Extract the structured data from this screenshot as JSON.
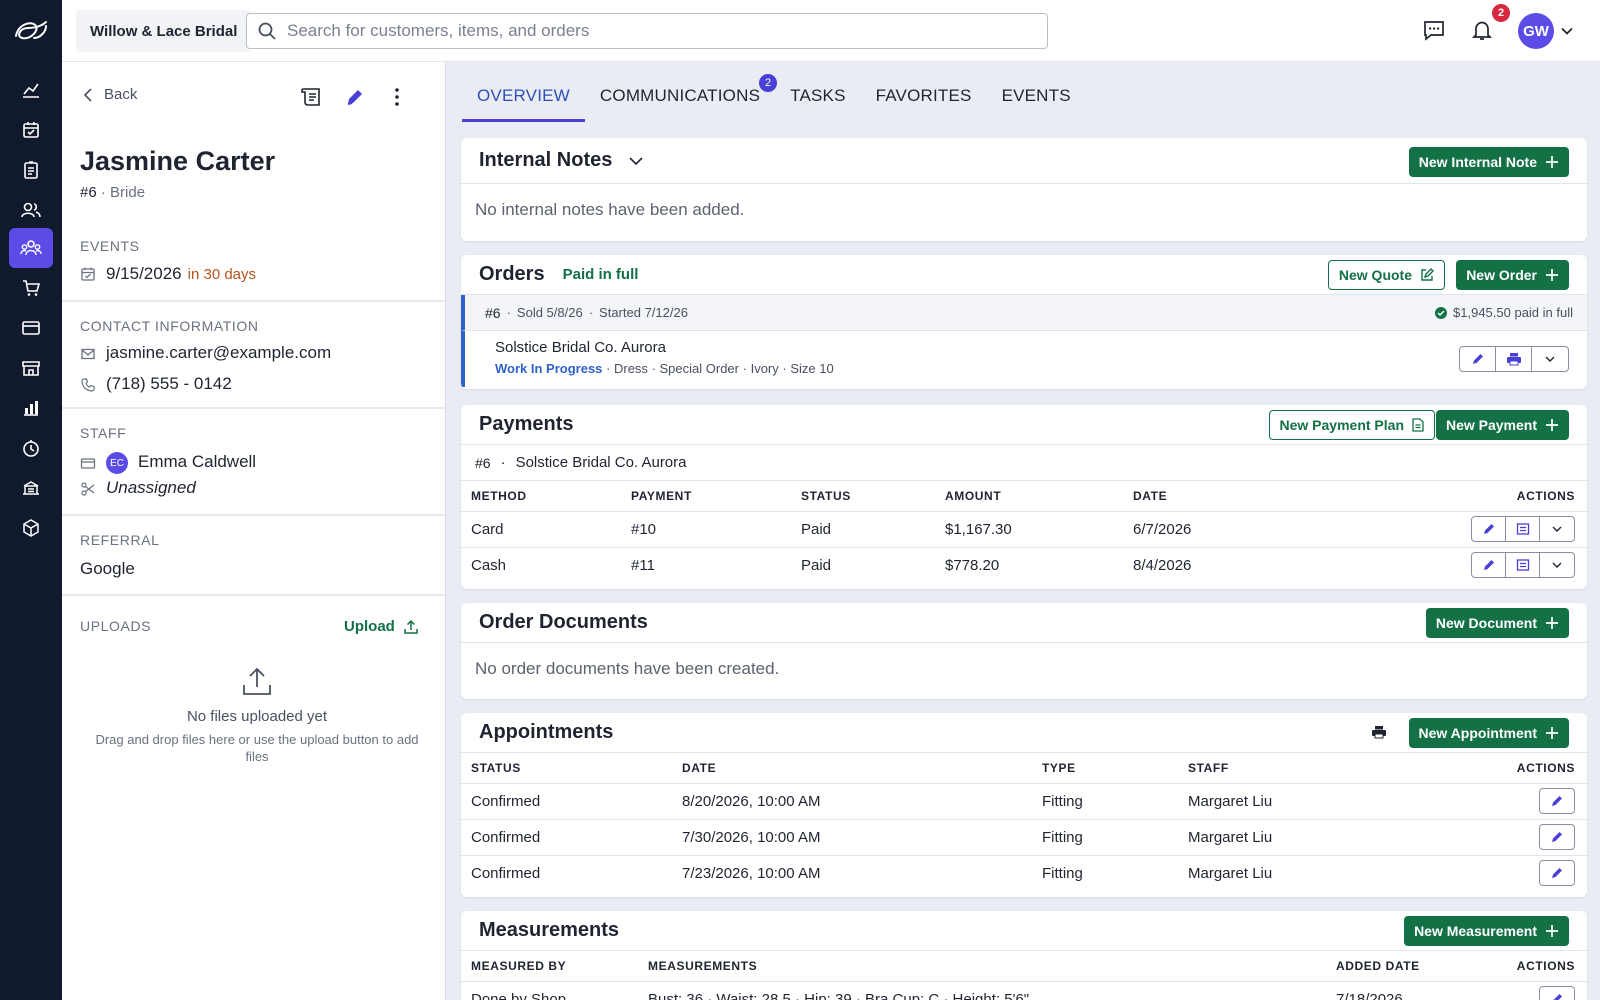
{
  "store": {
    "name": "Willow & Lace Bridal"
  },
  "search": {
    "placeholder": "Search for customers, items, and orders"
  },
  "topbar": {
    "notification_count": "2",
    "user_initials": "GW"
  },
  "rail": {
    "items": [
      "dashboard-icon",
      "calendar-check-icon",
      "clipboard-icon",
      "contacts-icon",
      "customers-icon",
      "cart-icon",
      "credit-card-icon",
      "storefront-icon",
      "reports-icon",
      "clock-icon",
      "orders-icon",
      "package-icon"
    ],
    "active": "customers-icon"
  },
  "customer": {
    "back_label": "Back",
    "name": "Jasmine Carter",
    "number": "#6",
    "role": "Bride",
    "events_label": "EVENTS",
    "event_date": "9/15/2026",
    "event_due": "in 30 days",
    "contact_label": "CONTACT INFORMATION",
    "email": "jasmine.carter@example.com",
    "phone": "(718) 555 - 0142",
    "staff_label": "STAFF",
    "staff_initials": "EC",
    "staff_name": "Emma Caldwell",
    "staff_unassigned": "Unassigned",
    "referral_label": "REFERRAL",
    "referral": "Google",
    "uploads_label": "UPLOADS",
    "upload_button": "Upload",
    "uploads_empty_title": "No files uploaded yet",
    "uploads_empty_text": "Drag and drop files here or use the upload button to add files"
  },
  "tabs": [
    {
      "label": "OVERVIEW",
      "active": true
    },
    {
      "label": "COMMUNICATIONS",
      "badge": "2"
    },
    {
      "label": "TASKS"
    },
    {
      "label": "FAVORITES"
    },
    {
      "label": "EVENTS"
    }
  ],
  "internal_notes": {
    "title": "Internal Notes",
    "button": "New Internal Note",
    "empty": "No internal notes have been added."
  },
  "orders": {
    "title": "Orders",
    "status": "Paid in full",
    "new_quote": "New Quote",
    "new_order": "New Order",
    "order_number": "#6",
    "sold": "Sold 5/8/26",
    "started": "Started 7/12/26",
    "paid_summary": "$1,945.50 paid in full",
    "item_name": "Solstice Bridal Co. Aurora",
    "item_status": "Work In Progress",
    "item_type": "Dress",
    "item_order_kind": "Special Order",
    "item_color": "Ivory",
    "item_size": "Size 10"
  },
  "payments": {
    "title": "Payments",
    "new_plan": "New Payment Plan",
    "new_payment": "New Payment",
    "order_number": "#6",
    "order_item": "Solstice Bridal Co. Aurora",
    "columns": [
      "METHOD",
      "PAYMENT",
      "STATUS",
      "AMOUNT",
      "DATE",
      "ACTIONS"
    ],
    "rows": [
      {
        "method": "Card",
        "payment": "#10",
        "status": "Paid",
        "amount": "$1,167.30",
        "date": "6/7/2026"
      },
      {
        "method": "Cash",
        "payment": "#11",
        "status": "Paid",
        "amount": "$778.20",
        "date": "8/4/2026"
      }
    ]
  },
  "documents": {
    "title": "Order Documents",
    "button": "New Document",
    "empty": "No order documents have been created."
  },
  "appointments": {
    "title": "Appointments",
    "button": "New Appointment",
    "columns": [
      "STATUS",
      "DATE",
      "TYPE",
      "STAFF",
      "ACTIONS"
    ],
    "rows": [
      {
        "status": "Confirmed",
        "date": "8/20/2026, 10:00 AM",
        "type": "Fitting",
        "staff": "Margaret Liu"
      },
      {
        "status": "Confirmed",
        "date": "7/30/2026, 10:00 AM",
        "type": "Fitting",
        "staff": "Margaret Liu"
      },
      {
        "status": "Confirmed",
        "date": "7/23/2026, 10:00 AM",
        "type": "Fitting",
        "staff": "Margaret Liu"
      }
    ]
  },
  "measurements": {
    "title": "Measurements",
    "button": "New Measurement",
    "columns": [
      "MEASURED BY",
      "MEASUREMENTS",
      "ADDED DATE",
      "ACTIONS"
    ],
    "rows": [
      {
        "measured_by": "Done by Shop",
        "measurements": "Bust: 36 · Waist: 28.5 · Hip: 39 · Bra Cup: C · Height: 5'6\"",
        "added_date": "7/18/2026"
      }
    ]
  },
  "colors": {
    "accent": "#5b4ce8",
    "brand_green": "#137145",
    "rail": "#111a2c",
    "link_blue": "#2f62c9"
  }
}
